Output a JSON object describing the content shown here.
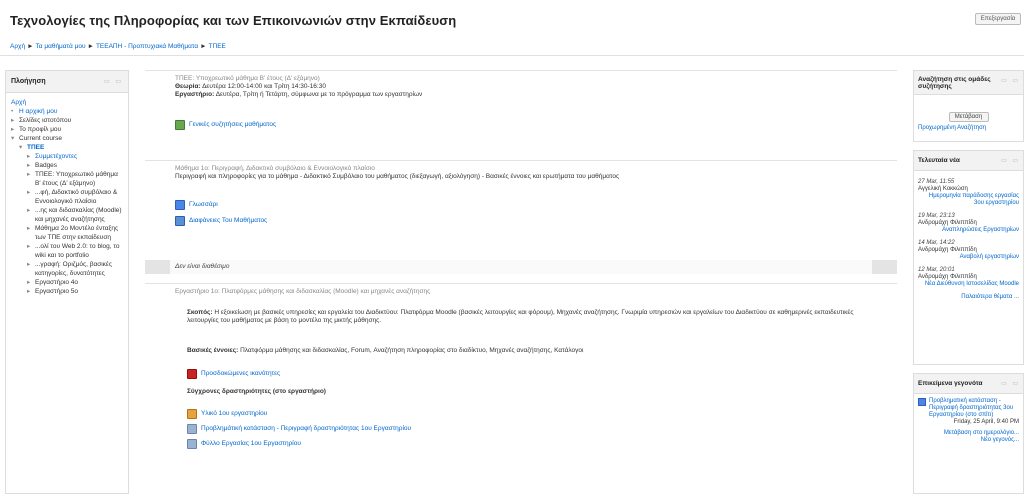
{
  "header": {
    "title": "Τεχνολογίες της Πληροφορίας και των Επικοινωνιών στην Εκπαίδευση",
    "login_label": "Επεξεργασία"
  },
  "breadcrumb": [
    "Αρχή",
    "Τα μαθήματά μου",
    "ΤΕΕΑΠΗ - Προπτυχιακά Μαθήματα",
    "ΤΠΕΕ"
  ],
  "nav": {
    "title": "Πλοήγηση",
    "home": "Αρχή",
    "items": [
      {
        "arrow": "•",
        "label": "Η αρχική μου",
        "link": true
      },
      {
        "arrow": "▸",
        "label": "Σελίδες ιστοτόπου",
        "link": false
      },
      {
        "arrow": "▸",
        "label": "Το προφίλ μου",
        "link": false
      },
      {
        "arrow": "▾",
        "label": "Current course",
        "link": false
      },
      {
        "arrow": "▾",
        "label": "ΤΠΕΕ",
        "link": true,
        "bold": true,
        "indent": 1
      },
      {
        "arrow": "▸",
        "label": "Συμμετέχοντες",
        "link": true,
        "indent": 2
      },
      {
        "arrow": "▸",
        "label": "Badges",
        "link": false,
        "indent": 2
      },
      {
        "arrow": "▸",
        "label": "ΤΠΕΕ: Υποχρεωτικό μάθημα Β' έτους (Δ' εξάμηνο)",
        "link": false,
        "indent": 2
      },
      {
        "arrow": "▸",
        "label": "...φή, Διδακτικό συμβόλαιο & Εννοιολογικό πλαίσιο",
        "link": false,
        "indent": 2
      },
      {
        "arrow": "▸",
        "label": "...ης και διδασκαλίας (Moodle) και μηχανές αναζήτησης",
        "link": false,
        "indent": 2
      },
      {
        "arrow": "▸",
        "label": "Μάθημα 2ο Μοντέλο ένταξης των ΤΠΕ στην εκπαίδευση",
        "link": false,
        "indent": 2
      },
      {
        "arrow": "▸",
        "label": "...ολί του Web 2.0: το blog, το wiki και το portfolio",
        "link": false,
        "indent": 2
      },
      {
        "arrow": "▸",
        "label": "...γραφή: Οριζμός, βασικές κατηγορίες, δυνατότητες",
        "link": false,
        "indent": 2
      },
      {
        "arrow": "▸",
        "label": "Εργαστήριο 4ο",
        "link": false,
        "indent": 2
      },
      {
        "arrow": "▸",
        "label": "Εργαστήριο 5ο",
        "link": false,
        "indent": 2
      }
    ]
  },
  "sections": {
    "s0": {
      "heading": "ΤΠΕΕ: Υποχρεωτικό μάθημα Β' έτους (Δ' εξάμηνο)",
      "theory_label": "Θεωρία:",
      "theory_text": "Δευτέρα 12:00-14:00 και Τρίτη 14:30-16:30",
      "lab_label": "Εργαστήριο:",
      "lab_text": "Δευτέρα, Τρίτη ή Τετάρτη, σύμφωνα με το πρόγραμμα των εργαστηρίων",
      "forum_link": "Γενικές συζητήσεις μαθήματος"
    },
    "s1": {
      "heading": "Μάθημα 1ο: Περιγραφή, Διδακτικό συμβόλαιο & Εννοιολογικό πλαίσιο",
      "desc": "Περιγραφή και πληροφορίες για το μάθημα - Διδακτικό Συμβόλαιο του μαθήματος (διεξαγωγή, αξιολόγηση) - Βασικές έννοιες και ερωτήματα του μαθήματος",
      "links": [
        "Γλωσσάρι",
        "Διαφάνειες Του Μαθήματος"
      ]
    },
    "unavailable": "Δεν είναι διαθέσιμο",
    "s2": {
      "heading": "Εργαστήριο 1ο: Πλατφόρμες μάθησης και διδασκαλίας (Moodle) και μηχανές αναζήτησης",
      "goal_label": "Σκοπός:",
      "goal_text": "Η εξοικείωση με βασικές υπηρεσίες και εργαλεία του Διαδικτύου: Πλατφόρμα Moodle (βασικές λειτουργίες και φόρουμ), Μηχανές αναζήτησης. Γνωριμία υπηρεσιών και εργαλείων του Διαδικτύου σε καθημερινές εκπαιδευτικές λειτουργίες του μαθήματος με βάση το μοντέλο της μικτής μάθησης.",
      "concepts_label": "Βασικές έννοιες:",
      "concepts_text": "Πλατφόρμα μάθησης και διδασκαλίας, Forum, Αναζήτηση πληροφορίας στο διαδίκτυο, Μηχανές αναζήτησης, Κατάλογοι",
      "pdf_link": "Προσδοκώμενες ικανότητες",
      "activities_heading": "Σύγχρονες δραστηριότητες (στο εργαστήριο)",
      "activity_links": [
        "Υλικό 1ου εργαστηρίου",
        "Προβλημάτική κατάσταση - Περιγραφή δραστηριότητας 1ου Εργαστηρίου",
        "Φύλλο Εργασίας 1ου Εργαστηρίου"
      ]
    }
  },
  "right": {
    "search": {
      "title": "Αναζήτηση στις ομάδες συζήτησης",
      "button": "Μετάβαση",
      "advanced": "Προχωρημένη Αναζήτηση"
    },
    "news": {
      "title": "Τελευταία νέα",
      "items": [
        {
          "date": "27 Mar, 11:55",
          "author": "Αγγελική Κοκκώση",
          "subject": "Ημερομηνία παράδοσης εργασίας 3ου εργαστηρίου"
        },
        {
          "date": "19 Mar, 23:13",
          "author": "Ανδρομάχη Φιλιππίδη",
          "subject": "Αναπληρώσεις Εργαστηρίων"
        },
        {
          "date": "14 Mar, 14:22",
          "author": "Ανδρομάχη Φιλιππίδη",
          "subject": "Αναβολή εργαστηρίων"
        },
        {
          "date": "12 Mar, 20:01",
          "author": "Ανδρομάχη Φιλιππίδη",
          "subject": "Νέα Διεύθυνση Ιστοσελίδας Moodle"
        }
      ],
      "older": "Παλαιότερα θέματα ..."
    },
    "events": {
      "title": "Επικείμενα γεγονότα",
      "event_title": "Προβληματική κατάσταση - Περιγραφή δραστηριότητας 3ου Εργαστηρίου (στο σπίτι)",
      "event_date": "Friday, 25 April, 9:40 PM",
      "calendar_link": "Μετάβαση στο ημερολόγιο...",
      "new_event": "Νέο γεγονός..."
    }
  },
  "colors": {
    "link": "#0066cc",
    "forum_icon": "#6aa84f",
    "pdf_icon": "#cc2222"
  }
}
